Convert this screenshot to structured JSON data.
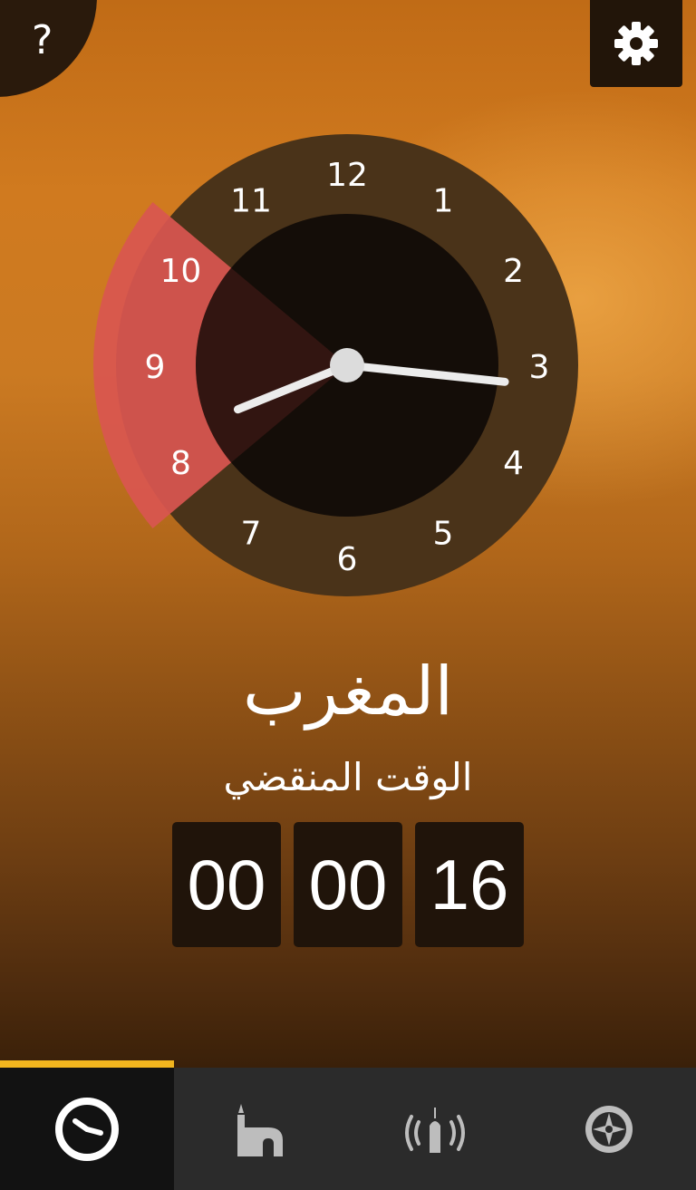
{
  "header": {
    "help_glyph": "?",
    "settings_icon": "gear-icon",
    "help_icon": "help-icon"
  },
  "clock": {
    "numbers": [
      "12",
      "1",
      "2",
      "3",
      "4",
      "5",
      "6",
      "7",
      "8",
      "9",
      "10",
      "11"
    ],
    "time": {
      "hour": 8,
      "minute": 16
    },
    "highlight_arc": {
      "from_hour": 8,
      "to_hour": 10
    },
    "colors": {
      "ring": "#4a3319",
      "face": "#140d08",
      "hands": "#ececec",
      "arc": "#d95650"
    }
  },
  "prayer": {
    "name": "المغرب",
    "elapsed_label": "الوقت المنقضي"
  },
  "timer": {
    "segments": [
      "00",
      "00",
      "16"
    ]
  },
  "tabs": [
    {
      "icon": "clock-icon",
      "active": true
    },
    {
      "icon": "mosque-icon",
      "active": false
    },
    {
      "icon": "adhan-broadcast-icon",
      "active": false
    },
    {
      "icon": "compass-icon",
      "active": false
    }
  ],
  "colors": {
    "accent": "#f2b51e",
    "tabbar": "#2b2b2b",
    "tab_active": "#121212"
  }
}
